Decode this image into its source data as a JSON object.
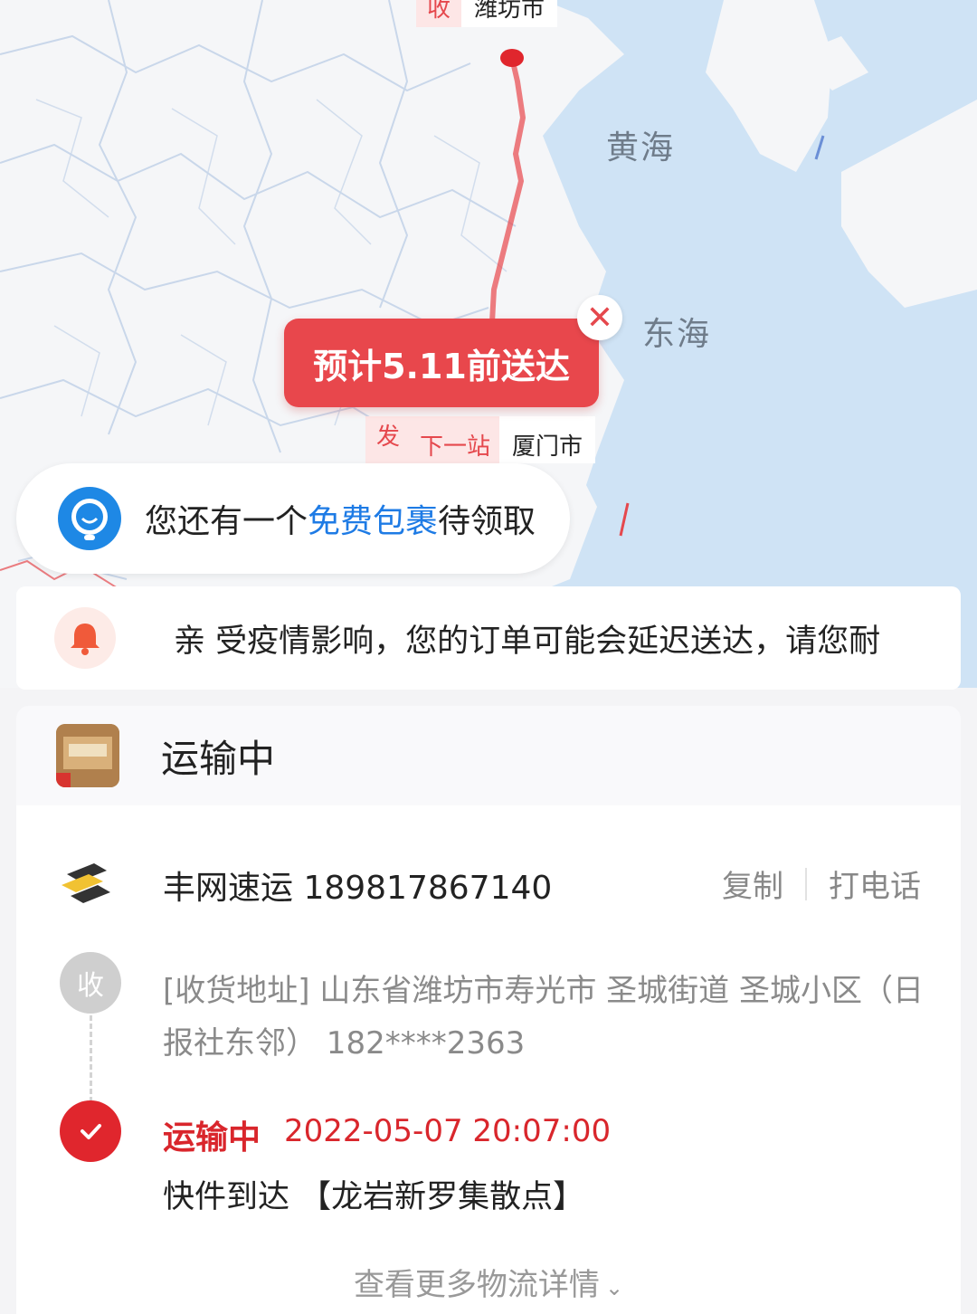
{
  "map": {
    "sea_labels": [
      "黄海",
      "东海"
    ],
    "destination_tag": {
      "mark": "收",
      "city": "潍坊市"
    },
    "origin_tag": {
      "mark": "发",
      "next_label": "下一站",
      "next_city": "厦门市"
    },
    "eta_text": "预计5.11前送达",
    "close_icon": "close-icon",
    "route_color": "#e8474c"
  },
  "promo": {
    "prefix": "您还有一个",
    "highlight": "免费包裹",
    "suffix": "待领取"
  },
  "notice": {
    "text": "亲 受疫情影响，您的订单可能会延迟送达，请您耐"
  },
  "order": {
    "status_title": "运输中"
  },
  "courier": {
    "name_and_number": "丰网速运 189817867140",
    "copy_label": "复制",
    "call_label": "打电话"
  },
  "address": {
    "dot_label": "收",
    "text": "[收货地址] 山东省潍坊市寿光市 圣城街道 圣城小区（日报社东邻） 182****2363"
  },
  "latest_event": {
    "status": "运输中",
    "time": "2022-05-07 20:07:00",
    "description": "快件到达 【龙岩新罗集散点】"
  },
  "more_link": "查看更多物流详情",
  "colors": {
    "accent_red": "#e0262d",
    "link_blue": "#1e7be5",
    "sea": "#cfe3f5"
  }
}
